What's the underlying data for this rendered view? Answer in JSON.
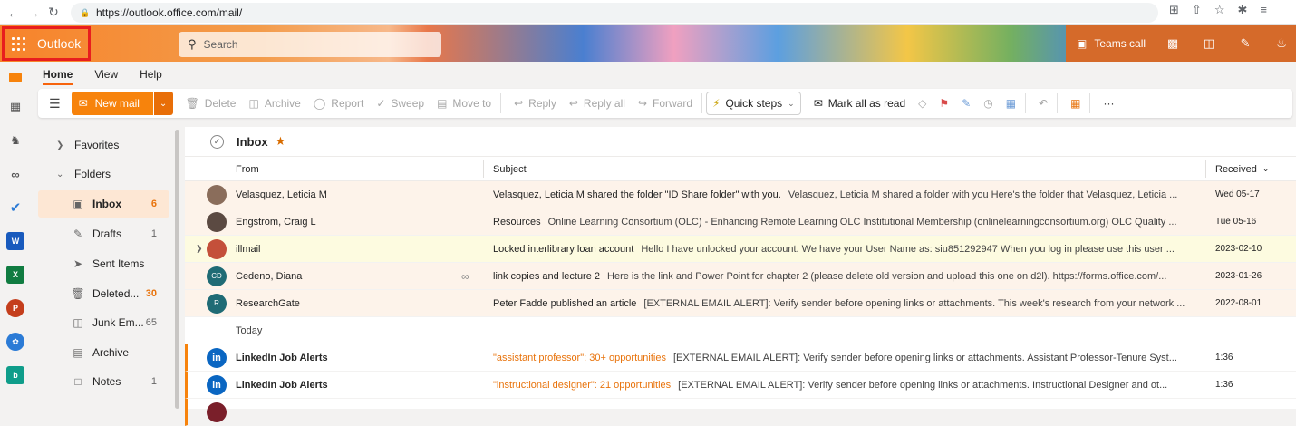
{
  "browser": {
    "url": "https://outlook.office.com/mail/"
  },
  "header": {
    "app_name": "Outlook",
    "search_placeholder": "Search",
    "teams_call": "Teams call"
  },
  "menu": {
    "tabs": [
      "Home",
      "View",
      "Help"
    ]
  },
  "ribbon": {
    "new_mail": "New mail",
    "delete": "Delete",
    "archive": "Archive",
    "report": "Report",
    "sweep": "Sweep",
    "move_to": "Move to",
    "reply": "Reply",
    "reply_all": "Reply all",
    "forward": "Forward",
    "quick_steps": "Quick steps",
    "mark_all_read": "Mark all as read",
    "more": "···"
  },
  "folders": {
    "favorites": "Favorites",
    "folders": "Folders",
    "items": [
      {
        "label": "Inbox",
        "count": "6",
        "icon": "inbox-icon"
      },
      {
        "label": "Drafts",
        "count": "1",
        "icon": "drafts-icon"
      },
      {
        "label": "Sent Items",
        "count": "",
        "icon": "send-icon"
      },
      {
        "label": "Deleted...",
        "count": "30",
        "icon": "trash-icon"
      },
      {
        "label": "Junk Em...",
        "count": "65",
        "icon": "junk-icon"
      },
      {
        "label": "Archive",
        "count": "",
        "icon": "archive-icon"
      },
      {
        "label": "Notes",
        "count": "1",
        "icon": "notes-icon"
      }
    ]
  },
  "list": {
    "title": "Inbox",
    "col_from": "From",
    "col_subject": "Subject",
    "col_received": "Received",
    "group_today": "Today",
    "mails": [
      {
        "from": "Velasquez, Leticia M",
        "subject": "Velasquez, Leticia M shared the folder \"ID Share folder\" with you.",
        "preview": "Velasquez, Leticia M shared a folder with you Here's the folder that Velasquez, Leticia ...",
        "date": "Wed 05-17",
        "avatar": "",
        "avatar_color": "#8a6d5b"
      },
      {
        "from": "Engstrom, Craig L",
        "subject": "Resources",
        "preview": "Online Learning Consortium (OLC) - Enhancing Remote Learning OLC Institutional Membership (onlinelearningconsortium.org) OLC Quality ...",
        "date": "Tue 05-16",
        "avatar": "",
        "avatar_color": "#5b4a42"
      },
      {
        "from": "illmail",
        "subject": "Locked interlibrary loan account",
        "preview": "Hello I have unlocked your account. We have your User Name as: siu851292947 When you log in please use this user ...",
        "date": "2023-02-10",
        "avatar": "",
        "avatar_color": "#c4503a"
      },
      {
        "from": "Cedeno, Diana",
        "subject": "link copies and lecture 2",
        "preview": "Here is the link and Power Point for chapter 2 (please delete old version and upload this one on d2l). https://forms.office.com/...",
        "date": "2023-01-26",
        "avatar": "CD",
        "avatar_color": "#1f6b75"
      },
      {
        "from": "ResearchGate",
        "subject": "Peter Fadde published an article",
        "preview": "[EXTERNAL EMAIL ALERT]: Verify sender before opening links or attachments. This week's research from your network ...",
        "date": "2022-08-01",
        "avatar": "R",
        "avatar_color": "#1f6b75"
      },
      {
        "from": "LinkedIn Job Alerts",
        "subject": "\"assistant professor\": 30+ opportunities",
        "preview": "[EXTERNAL EMAIL ALERT]: Verify sender before opening links or attachments. Assistant Professor-Tenure Syst...",
        "date": "1:36",
        "avatar": "in",
        "avatar_color": "#0a66c2"
      },
      {
        "from": "LinkedIn Job Alerts",
        "subject": "\"instructional designer\": 21 opportunities",
        "preview": "[EXTERNAL EMAIL ALERT]: Verify sender before opening links or attachments. Instructional Designer and ot...",
        "date": "1:36",
        "avatar": "in",
        "avatar_color": "#0a66c2"
      }
    ]
  },
  "colors": {
    "accent": "#f7830c",
    "folder_active_bg": "#fde7d4",
    "unread_tint": "#fdf3ea"
  }
}
